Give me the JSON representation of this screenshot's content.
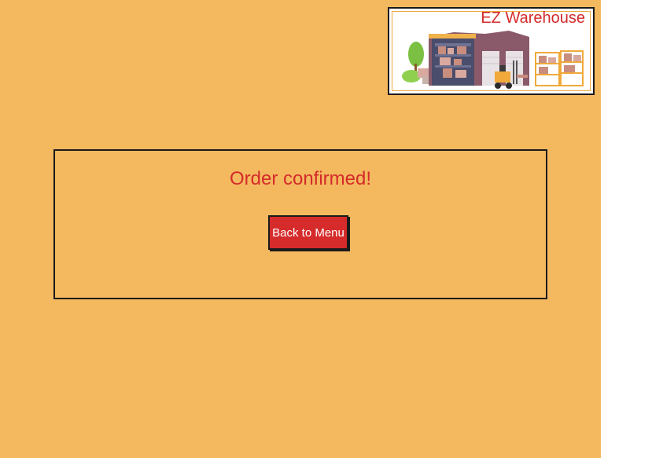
{
  "brand": {
    "title": "EZ Warehouse",
    "logo_icon": "warehouse-forklift-illustration"
  },
  "confirmation": {
    "message": "Order confirmed!",
    "back_button_label": "Back to Menu"
  },
  "colors": {
    "background": "#f4b95f",
    "accent_red": "#d42a2a",
    "border": "#1a1a1a"
  }
}
